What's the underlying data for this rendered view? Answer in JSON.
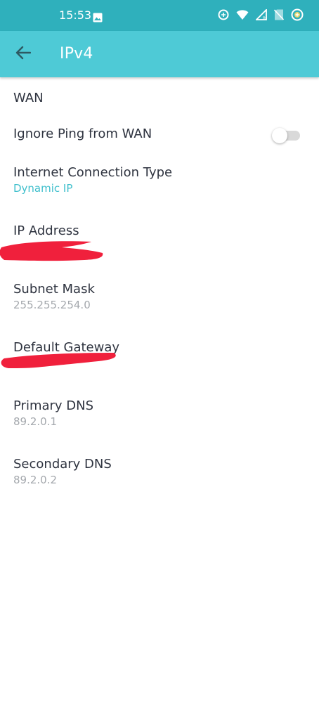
{
  "status_bar": {
    "time": "15:53",
    "icons": [
      "image-icon",
      "data-saver-icon",
      "wifi-icon",
      "signal-icon",
      "no-sim-icon",
      "battery-icon"
    ]
  },
  "app_bar": {
    "title": "IPv4",
    "back_icon": "arrow-left-icon"
  },
  "section": {
    "title": "WAN"
  },
  "rows": {
    "ignore_ping": {
      "label": "Ignore Ping from WAN",
      "toggle_on": false
    },
    "connection_type": {
      "label": "Internet Connection Type",
      "value": "Dynamic IP"
    },
    "ip_address": {
      "label": "IP Address",
      "value_redacted": true
    },
    "subnet_mask": {
      "label": "Subnet Mask",
      "value": "255.255.254.0"
    },
    "default_gateway": {
      "label": "Default Gateway",
      "value_redacted": true
    },
    "primary_dns": {
      "label": "Primary DNS",
      "value": "89.2.0.1"
    },
    "secondary_dns": {
      "label": "Secondary DNS",
      "value": "89.2.0.2"
    }
  },
  "colors": {
    "status_bar": "#2fb0bc",
    "app_bar": "#4ecad6",
    "accent_link": "#3fbfcc",
    "text_primary": "#2f3440",
    "text_secondary": "#a4a8ad",
    "redaction": "#f0203c"
  }
}
